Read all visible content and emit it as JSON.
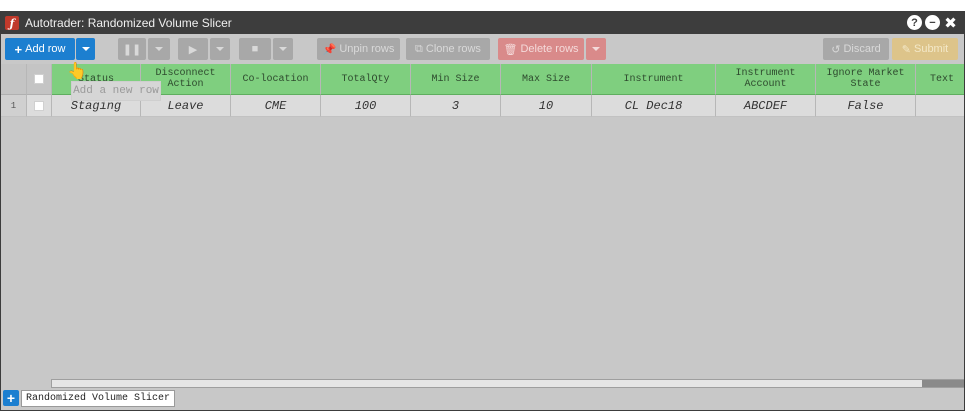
{
  "window": {
    "title": "Autotrader: Randomized Volume Slicer"
  },
  "title_icons": {
    "help": "?",
    "minimize": "−",
    "close": "✖"
  },
  "toolbar": {
    "add_row": "Add row",
    "unpin_rows": "Unpin rows",
    "clone_rows": "Clone rows",
    "delete_rows": "Delete rows",
    "discard": "Discard",
    "submit": "Submit",
    "tooltip": "Add a new row"
  },
  "grid": {
    "headers": [
      "",
      "",
      "Status",
      "Disconnect Action",
      "Co-location",
      "TotalQty",
      "Min Size",
      "Max Size",
      "Instrument",
      "Instrument Account",
      "Ignore Market State",
      "Text"
    ],
    "rows": [
      {
        "index": "1",
        "status": "Staging",
        "disconnect_action": "Leave",
        "co_location": "CME",
        "total_qty": "100",
        "min_size": "3",
        "max_size": "10",
        "instrument": "CL Dec18",
        "instrument_account": "ABCDEF",
        "ignore_market_state": "False",
        "text": ""
      }
    ]
  },
  "footer": {
    "tab_label": "Randomized Volume Slicer"
  },
  "colors": {
    "accent": "#1c7fd0",
    "header_green": "#7fcf7f",
    "delete_red": "#d98a8a"
  }
}
